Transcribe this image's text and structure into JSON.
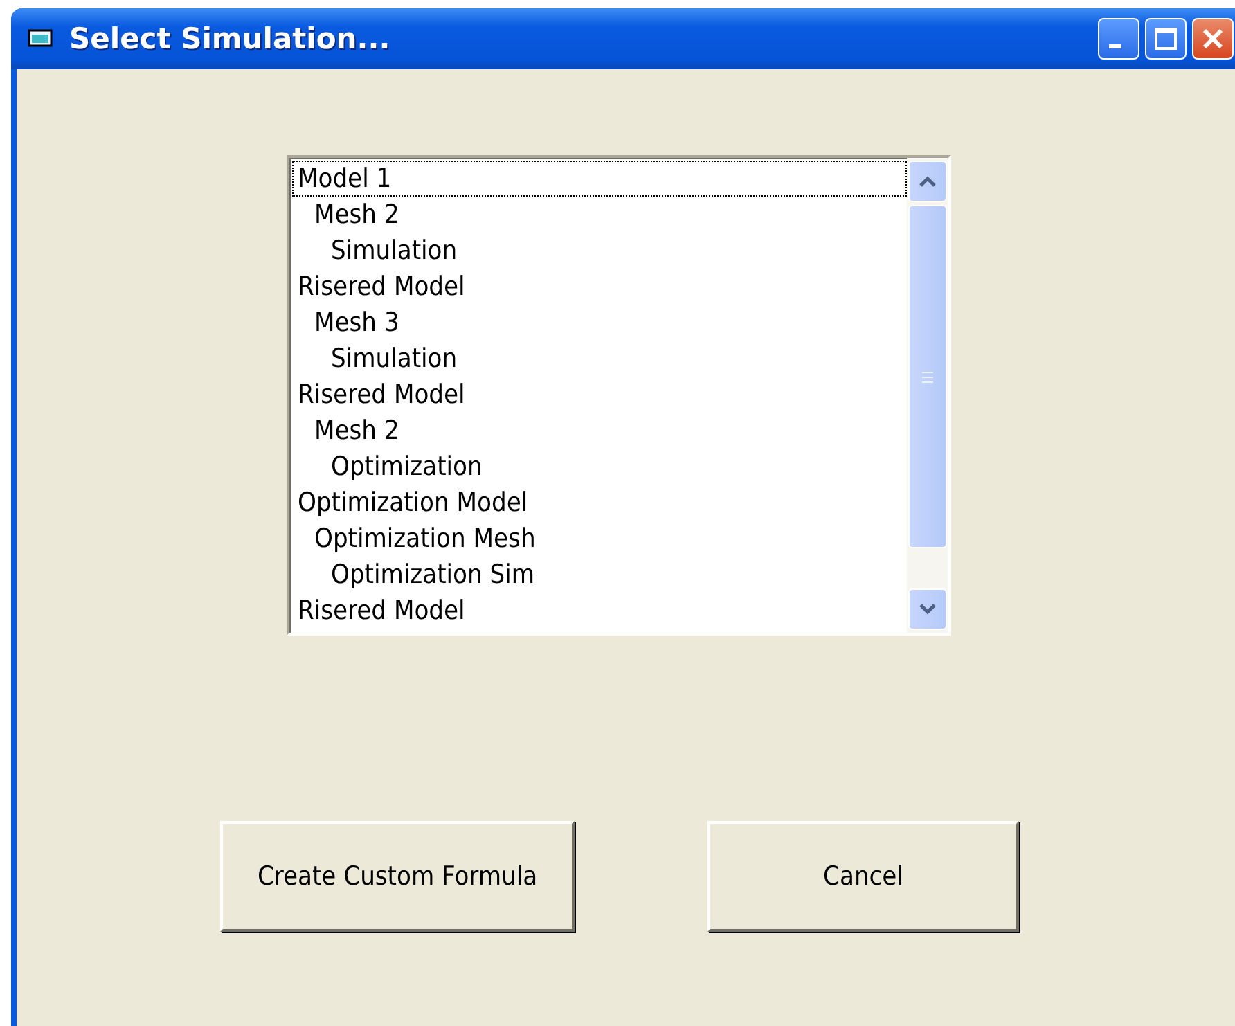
{
  "window": {
    "title": "Select Simulation..."
  },
  "list": {
    "items": [
      {
        "label": "Model 1",
        "focused": true,
        "children": [
          {
            "label": "Mesh 2",
            "focused": false,
            "children": [
              {
                "label": "Simulation",
                "focused": false
              }
            ]
          }
        ]
      },
      {
        "label": "Risered Model",
        "focused": false,
        "children": [
          {
            "label": "Mesh 3",
            "focused": false,
            "children": [
              {
                "label": "Simulation",
                "focused": false
              }
            ]
          }
        ]
      },
      {
        "label": "Risered Model",
        "focused": false,
        "children": [
          {
            "label": "Mesh 2",
            "focused": false,
            "children": [
              {
                "label": "Optimization",
                "focused": false
              }
            ]
          }
        ]
      },
      {
        "label": "Optimization Model",
        "focused": false,
        "children": [
          {
            "label": "Optimization Mesh",
            "focused": false,
            "children": [
              {
                "label": "Optimization Sim",
                "focused": false
              }
            ]
          }
        ]
      },
      {
        "label": "Risered Model",
        "focused": false
      }
    ]
  },
  "buttons": [
    {
      "label": "Create Custom Formula"
    },
    {
      "label": "Cancel"
    }
  ]
}
